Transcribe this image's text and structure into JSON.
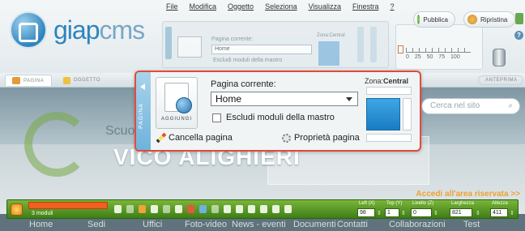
{
  "brand": {
    "name_part1": "giap",
    "name_part2": "cms"
  },
  "menu": [
    "File",
    "Modifica",
    "Oggetto",
    "Seleziona",
    "Visualizza",
    "Finestra",
    "?"
  ],
  "header_buttons": {
    "publish": "Pubblica",
    "restore": "Ripristina"
  },
  "ruler": {
    "scale": "0 25 50 75 100"
  },
  "tabs": {
    "page": "PAGINA",
    "object": "OGGETTO",
    "preview": "ANTEPRIMA"
  },
  "panel": {
    "side_tab": "PAGINA",
    "add_button": "AGGIUNGI",
    "current_page_label": "Pagina corrente:",
    "current_page_value": "Home",
    "exclude_master_label": "Escludi moduli della mastro",
    "delete_page": "Cancella pagina",
    "page_properties": "Proprietà pagina",
    "zone_label": "Zona:",
    "zone_value": "Central"
  },
  "ghost_toolbar": {
    "label": "Pagina corrente:",
    "value": "Home",
    "checkbox": "Escludi moduli della mastro",
    "zone": "Zona:Central"
  },
  "site": {
    "school_partial": "Scuol",
    "school_big": "VICO ALIGHIERI",
    "search_placeholder": "Cerca nel sito",
    "reserved_area": "Accedi all'area riservata >>",
    "nav": [
      "Home",
      "Sedi",
      "Uffici",
      "Foto-video",
      "News - eventi",
      "Documenti",
      "Contatti",
      "Collaborazioni",
      "Test"
    ]
  },
  "statusbar": {
    "selection_text": "",
    "modules_count": "3 moduli",
    "left_label": "Left (X)",
    "left_value": "98",
    "top_label": "Top (Y)",
    "top_value": "1",
    "level_label": "Livello (Z)",
    "level_value": "0",
    "width_label": "Larghezza",
    "width_value": "821",
    "height_label": "Altezza",
    "height_value": "411"
  }
}
